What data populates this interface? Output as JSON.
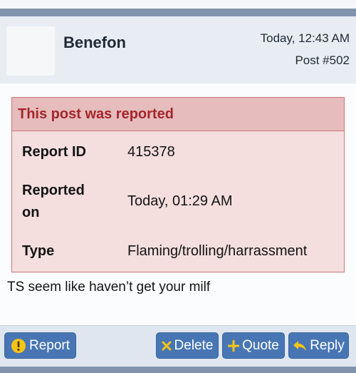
{
  "post": {
    "username": "Benefon",
    "time": "Today, 12:43 AM",
    "number": "Post #502",
    "message": "TS seem like haven’t get your milf"
  },
  "report": {
    "title": "This post was reported",
    "fields": [
      {
        "label": "Report ID",
        "value": "415378"
      },
      {
        "label_line1": "Reported",
        "label_line2": "on",
        "value": "Today, 01:29 AM"
      },
      {
        "label": "Type",
        "value": "Flaming/trolling/harrassment"
      }
    ]
  },
  "actions": {
    "report_label": "Report",
    "delete_label": "Delete",
    "quote_label": "Quote",
    "reply_label": "Reply"
  },
  "icons": {
    "report": "alert-circle-icon",
    "delete": "x-icon",
    "quote": "plus-icon",
    "reply": "reply-arrow-icon"
  },
  "colors": {
    "header_bar": "#8193ad",
    "report_accent": "#a3262b",
    "report_bg": "#f4dede",
    "button_bg": "#4876b4",
    "warning_icon": "#f6c514"
  }
}
